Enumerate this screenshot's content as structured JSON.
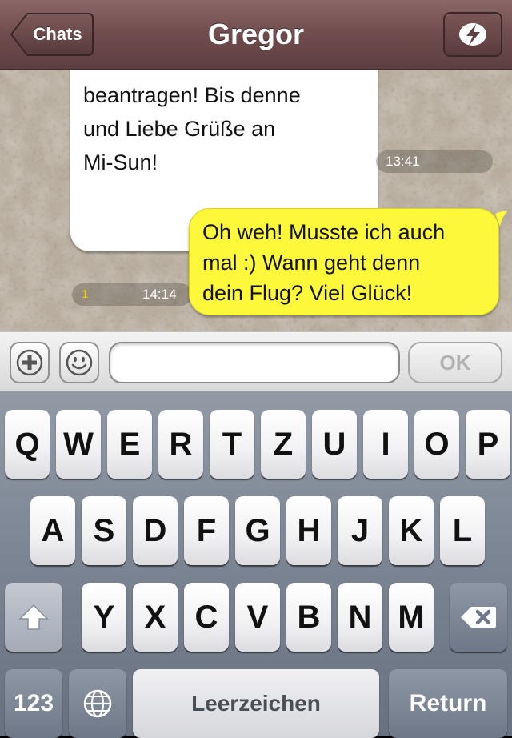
{
  "navbar": {
    "back_label": "Chats",
    "title": "Gregor",
    "action_icon": "lightning-bolt-icon"
  },
  "messages": [
    {
      "direction": "incoming",
      "lines": [
        "beantragen! Bis denne",
        "und Liebe Grüße an",
        "Mi-Sun!"
      ],
      "time": "13:41"
    },
    {
      "direction": "outgoing",
      "lines": [
        "Oh weh! Musste ich auch",
        "mal :) Wann geht denn",
        "dein Flug? Viel Glück!"
      ],
      "time": "14:14",
      "status": "1"
    }
  ],
  "input_bar": {
    "add_icon": "plus-icon",
    "emoji_icon": "smiley-icon",
    "message_value": "",
    "send_label": "OK"
  },
  "keyboard": {
    "row1": [
      "Q",
      "W",
      "E",
      "R",
      "T",
      "Z",
      "U",
      "I",
      "O",
      "P"
    ],
    "row2": [
      "A",
      "S",
      "D",
      "F",
      "G",
      "H",
      "J",
      "K",
      "L"
    ],
    "row3": [
      "Y",
      "X",
      "C",
      "V",
      "B",
      "N",
      "M"
    ],
    "shift_icon": "shift-arrow-icon",
    "delete_icon": "backspace-icon",
    "numbers_label": "123",
    "globe_icon": "globe-icon",
    "space_label": "Leerzeichen",
    "return_label": "Return"
  },
  "colors": {
    "navbar": "#6f4c4d",
    "outgoing_bubble": "#fdf83a",
    "incoming_bubble": "#ffffff",
    "keyboard": "#7f8896"
  }
}
